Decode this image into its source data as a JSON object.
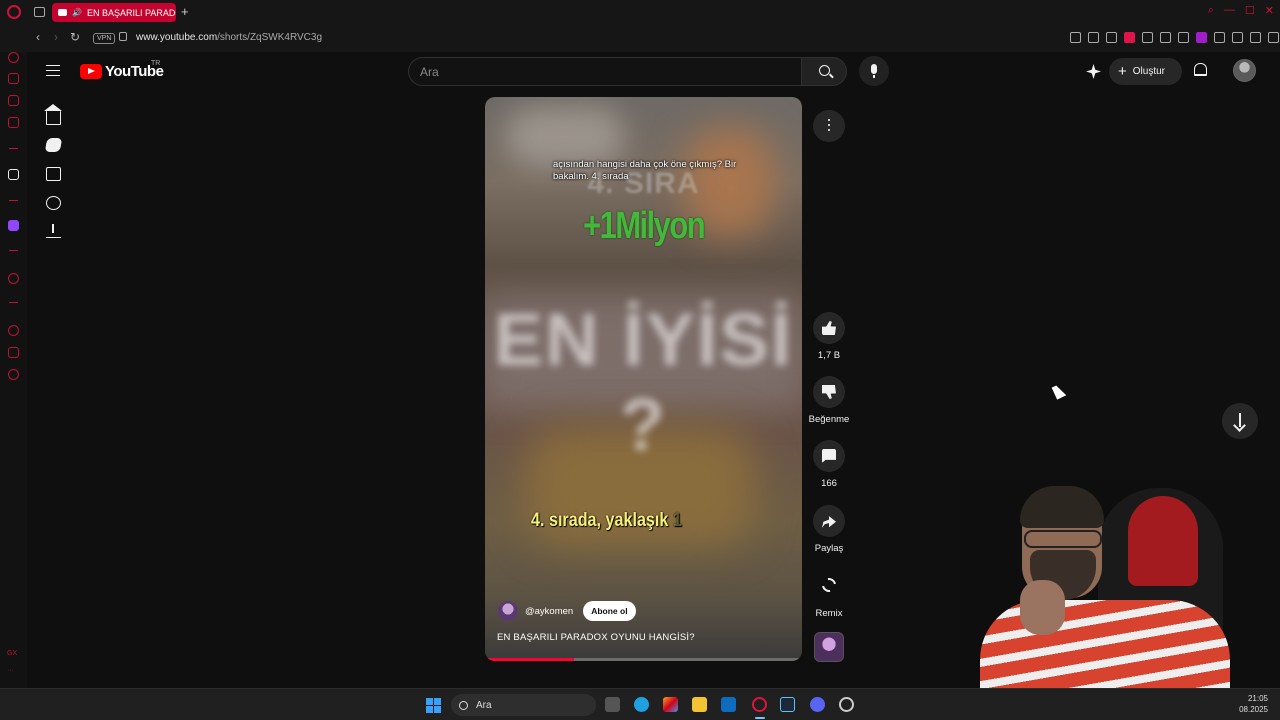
{
  "browser": {
    "tab_title": "EN BAŞARILI PARADO",
    "url_host": "www.youtube.com",
    "url_path": "/shorts/ZqSWK4RVC3g",
    "vpn_label": "VPN",
    "new_tab": "+",
    "sidebar_bottom_label": "GX"
  },
  "youtube": {
    "logo_text": "YouTube",
    "country_code": "TR",
    "search_placeholder": "Ara",
    "create_label": "Oluştur"
  },
  "short": {
    "caption_top": "açısından hangisi daha çok öne çıkmış? Bir bakalım. 4. sırada",
    "overlay_rank": "4. SIRA",
    "overlay_amount": "+1Milyon",
    "overlay_blur": "EN İYİSİ ?",
    "overlay_bottom": "4. sırada, yaklaşık",
    "overlay_bottom_trailing": "1",
    "channel": "@aykomen",
    "subscribe_label": "Abone ol",
    "title": "EN BAŞARILI PARADOX OYUNU HANGİSİ?",
    "progress_fraction": 0.28
  },
  "actions": {
    "likes": "1,7 B",
    "dislike_label": "Beğenme",
    "comments": "166",
    "share_label": "Paylaş",
    "remix_label": "Remix"
  },
  "taskbar": {
    "search_label": "Ara",
    "time": "21:05",
    "date": "08.2025"
  },
  "colors": {
    "youtube_red": "#ff0000",
    "opera_tab": "#c4042f",
    "background": "#0f0f0f",
    "overlay_green": "#44b83a",
    "overlay_yellow": "#f4f07a"
  }
}
